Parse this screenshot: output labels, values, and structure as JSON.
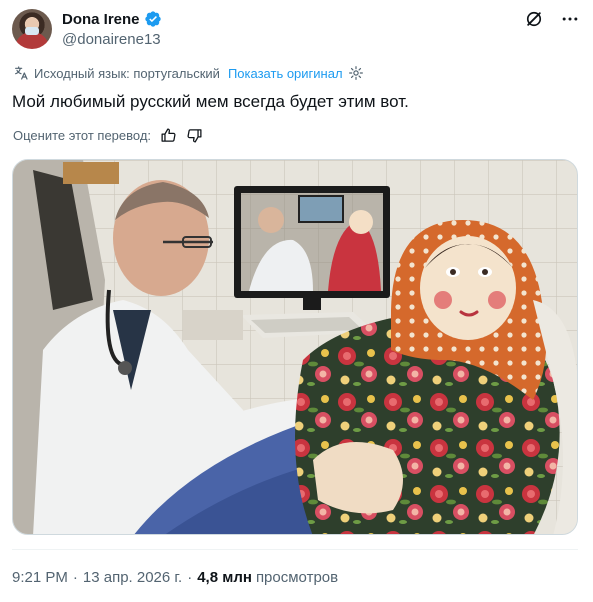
{
  "author": {
    "display_name": "Dona Irene",
    "handle": "@donairene13",
    "verified": true,
    "verified_color": "#1d9bf0"
  },
  "header_icons": [
    "grok-slash-icon",
    "more-icon"
  ],
  "translation": {
    "source_label": "Исходный язык: португальский",
    "show_original": "Показать оригинал"
  },
  "tweet": {
    "text": "Мой любимый русский мем всегда будет этим вот."
  },
  "rate": {
    "label": "Оцените этот перевод:"
  },
  "media": {
    "kind": "photo"
  },
  "meta": {
    "time": "9:21 PM",
    "separator": "·",
    "date": "13 апр. 2026 г.",
    "views_count": "4,8 млн",
    "views_label": "просмотров"
  },
  "colors": {
    "text": "#0f1419",
    "secondary": "#536471",
    "link": "#1d9bf0",
    "border": "#cfd9de"
  }
}
